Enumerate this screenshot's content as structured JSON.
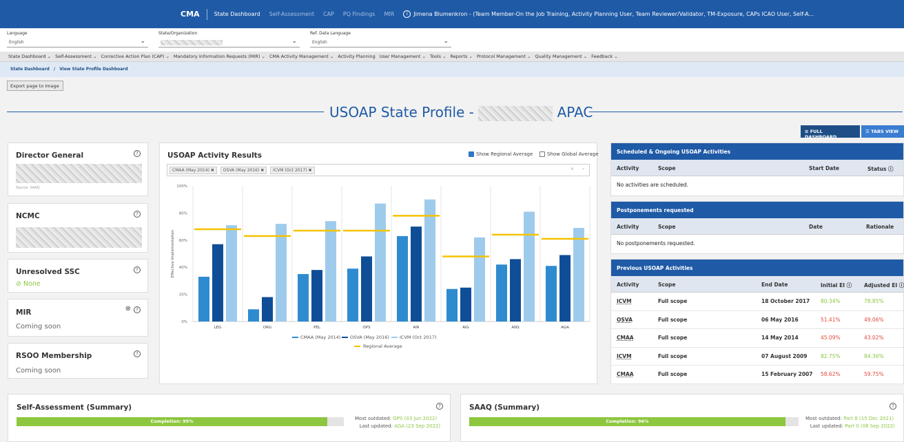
{
  "topbar": {
    "brand": "CMA",
    "nav": [
      "State Dashboard",
      "Self-Assessment",
      "CAP",
      "PQ Findings",
      "MIR"
    ],
    "user": "Jimena Blumenkron - (Team Member-On the Job Training, Activity Planning User, Team Reviewer/Validator, TM-Exposure, CAPs ICAO User, Self-A..."
  },
  "filters": {
    "language_label": "Language",
    "language_value": "English",
    "state_label": "State/Organization",
    "refdata_label": "Ref. Data Language",
    "refdata_value": "English"
  },
  "menu": [
    "State Dashboard ⌄",
    "Self-Assessment ⌄",
    "Corrective Action Plan (CAP) ⌄",
    "Mandatory Information Requests (MIR) ⌄",
    "CMA Activity Management ⌄",
    "Activity Planning",
    "User Management ⌄",
    "Tools ⌄",
    "Reports ⌄",
    "Protocol Management ⌄",
    "Quality Management ⌄",
    "Feedback ⌄"
  ],
  "breadcrumb": {
    "root": "State Dashboard",
    "sep": "/",
    "current": "View State Profile Dashboard"
  },
  "export_label": "Export page to Image",
  "page_title": {
    "prefix": "USOAP State Profile -",
    "suffix": "APAC"
  },
  "view_buttons": {
    "full": "FULL DASHBOARD",
    "tabs": "TABS VIEW"
  },
  "left_cards": {
    "director": {
      "title": "Director General",
      "source": "Source: SAAQ"
    },
    "ncmc": {
      "title": "NCMC"
    },
    "ssc": {
      "title": "Unresolved SSC",
      "value": "None"
    },
    "mir": {
      "title": "MIR",
      "value": "Coming soon"
    },
    "rsoo": {
      "title": "RSOO Membership",
      "value": "Coming soon"
    }
  },
  "activity_chart": {
    "title": "USOAP Activity Results",
    "show_regional": "Show Regional Average",
    "show_global": "Show Global Average",
    "tags": [
      "CMAA (May 2014)",
      "OSVA (May 2016)",
      "ICVM (Oct 2017)"
    ]
  },
  "chart_data": {
    "type": "bar",
    "categories": [
      "LEG",
      "ORG",
      "PEL",
      "OPS",
      "AIR",
      "AIG",
      "ANS",
      "AGA"
    ],
    "series": [
      {
        "name": "CMAA (May 2014)",
        "values": [
          33,
          9,
          35,
          39,
          63,
          24,
          42,
          41
        ],
        "color": "#2e8bd0"
      },
      {
        "name": "OSVA (May 2016)",
        "values": [
          57,
          18,
          38,
          48,
          70,
          25,
          46,
          49
        ],
        "color": "#0f4e96"
      },
      {
        "name": "ICVM (Oct 2017)",
        "values": [
          71,
          72,
          74,
          87,
          90,
          62,
          81,
          69
        ],
        "color": "#9ecbec"
      }
    ],
    "regional_average": {
      "name": "Regional Average",
      "values": [
        68,
        63,
        67,
        67,
        78,
        48,
        64,
        61
      ],
      "color": "#f5c200"
    },
    "ylabel": "Effective Implementation",
    "yticks": [
      "0%",
      "20%",
      "40%",
      "60%",
      "80%",
      "100%"
    ],
    "ylim": [
      0,
      100
    ],
    "legend_placement": "bottom",
    "grid": false
  },
  "scheduled": {
    "title": "Scheduled & Ongoing USOAP Activities",
    "columns": [
      "Activity",
      "Scope",
      "Start Date",
      "Status"
    ],
    "empty": "No activities are scheduled."
  },
  "postponements": {
    "title": "Postponements requested",
    "columns": [
      "Activity",
      "Scope",
      "Date",
      "Rationale"
    ],
    "empty": "No postponements requested."
  },
  "previous": {
    "title": "Previous USOAP Activities",
    "columns": [
      "Activity",
      "Scope",
      "End Date",
      "Initial EI",
      "Adjusted EI"
    ],
    "rows": [
      {
        "activity": "ICVM",
        "scope": "Full scope",
        "date": "18 October 2017",
        "initial": "80.34%",
        "adjusted": "78.85%",
        "color": "green"
      },
      {
        "activity": "OSVA",
        "scope": "Full scope",
        "date": "06 May 2016",
        "initial": "51.41%",
        "adjusted": "49.06%",
        "color": "red"
      },
      {
        "activity": "CMAA",
        "scope": "Full scope",
        "date": "14 May 2014",
        "initial": "45.09%",
        "adjusted": "43.02%",
        "color": "red"
      },
      {
        "activity": "ICVM",
        "scope": "Full scope",
        "date": "07 August 2009",
        "initial": "82.75%",
        "adjusted": "84.36%",
        "color": "green"
      },
      {
        "activity": "CMAA",
        "scope": "Full scope",
        "date": "15 February 2007",
        "initial": "58.62%",
        "adjusted": "59.75%",
        "color": "red"
      }
    ]
  },
  "self_assessment": {
    "title": "Self-Assessment (Summary)",
    "completion_label": "Completion: 95%",
    "completion": 0.95,
    "outdated_label": "Most outdated:",
    "outdated_value": "OPS (03 Jun 2022)",
    "updated_label": "Last updated:",
    "updated_value": "AGA (23 Sep 2022)"
  },
  "saaq": {
    "title": "SAAQ (Summary)",
    "completion_label": "Completion: 96%",
    "completion": 0.96,
    "outdated_label": "Most outdated:",
    "outdated_value": "Part 8 (15 Dec 2021)",
    "updated_label": "Last updated:",
    "updated_value": "Part 0 (06 Sep 2022)"
  }
}
